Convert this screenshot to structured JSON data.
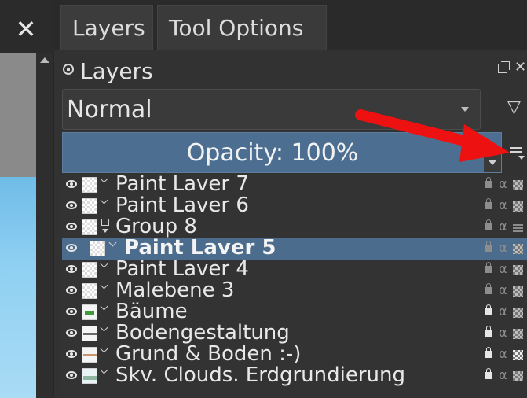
{
  "left": {
    "close_glyph": "✕"
  },
  "tabs": [
    {
      "label": "Layers",
      "active": true
    },
    {
      "label": "Tool Options",
      "active": false
    }
  ],
  "panel": {
    "title": "Layers",
    "blend_mode": "Normal",
    "opacity_label": "Opacity:  100%",
    "icons": [
      "lock-icon",
      "float-icon",
      "close-icon",
      "filter-icon",
      "menu-icon"
    ]
  },
  "layers": [
    {
      "name": "Paint Laver 7",
      "type": "paint",
      "locked": false
    },
    {
      "name": "Paint Laver 6",
      "type": "paint",
      "locked": false
    },
    {
      "name": "Group 8",
      "type": "group",
      "locked": false
    },
    {
      "name": "Paint Laver 5",
      "type": "paint",
      "locked": false,
      "selected": true
    },
    {
      "name": "Paint Laver 4",
      "type": "paint",
      "locked": false
    },
    {
      "name": "Malebene 3",
      "type": "paint",
      "locked": false
    },
    {
      "name": "Bäume",
      "type": "paint",
      "locked": true
    },
    {
      "name": "Bodengestaltung",
      "type": "paint",
      "locked": true
    },
    {
      "name": "Grund & Boden :-)",
      "type": "paint",
      "locked": true
    },
    {
      "name": "Skv. Clouds. Erdgrundierung",
      "type": "paint",
      "locked": true
    }
  ],
  "colors": {
    "selection": "#4b6c8c",
    "opacity_bar": "#4c6f91",
    "annotation_arrow": "#ee1111"
  }
}
